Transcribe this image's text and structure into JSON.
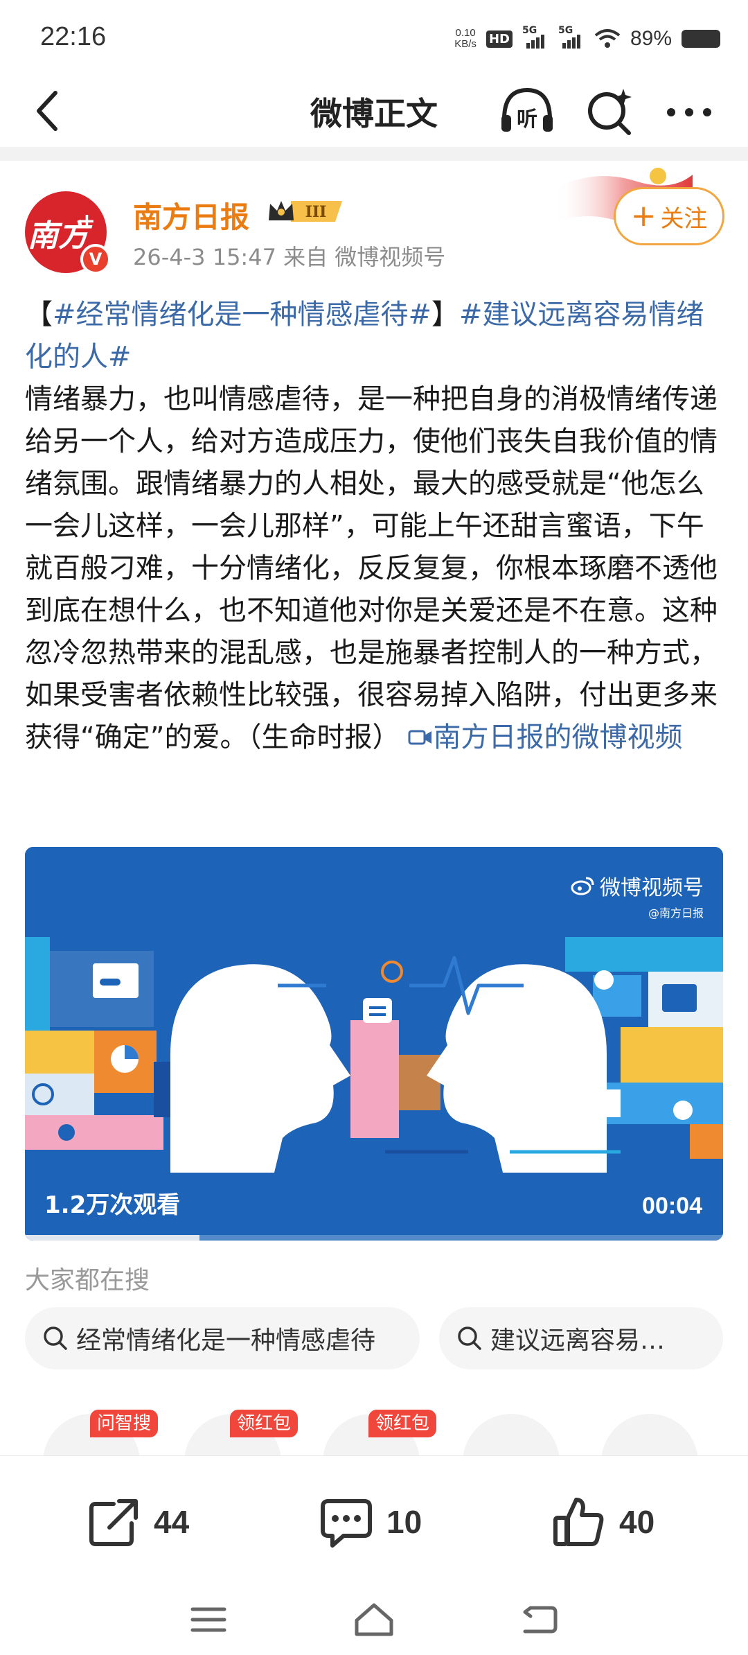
{
  "status_bar": {
    "time": "22:16",
    "net_speed_value": "0.10",
    "net_speed_unit": "KB/s",
    "hd_label": "HD",
    "sim1_label": "5G",
    "sim2_label": "5G",
    "battery": "89%"
  },
  "nav": {
    "title": "微博正文",
    "listen_label": "听"
  },
  "author": {
    "name": "南方日报",
    "avatar_text": "南方",
    "avatar_plus": "+",
    "verify_mark": "V",
    "level_badge": "III",
    "meta": "26-4-3 15:47  来自 微博视频号",
    "follow_plus": "+",
    "follow_label": "关注"
  },
  "post": {
    "bracket_open": "【",
    "tag1": "#经常情绪化是一种情感虐待#",
    "bracket_close": "】",
    "tag2": "#建议远离容易情绪化的人#",
    "body": "情绪暴力，也叫情感虐待，是一种把自身的消极情绪传递给另一个人，给对方造成压力，使他们丧失自我价值的情绪氛围。跟情绪暴力的人相处，最大的感受就是“他怎么一会儿这样，一会儿那样”，可能上午还甜言蜜语，下午就百般刁难，十分情绪化，反反复复，你根本琢磨不透他到底在想什么，也不知道他对你是关爱还是不在意。这种忽冷忽热带来的混乱感，也是施暴者控制人的一种方式，如果受害者依赖性比较强，很容易掉入陷阱，付出更多来获得“确定”的爱。（生命时报）",
    "video_link_label": "南方日报的微博视频"
  },
  "video": {
    "watermark_main": "微博视频号",
    "watermark_sub": "@南方日报",
    "views": "1.2万次观看",
    "duration": "00:04",
    "progress": 0.25
  },
  "hot_search": {
    "title": "大家都在搜",
    "chips": [
      "经常情绪化是一种情感虐待",
      "建议远离容易…"
    ]
  },
  "peek_badges": [
    "问智搜",
    "领红包",
    "领红包"
  ],
  "actions": {
    "share_count": "44",
    "comment_count": "10",
    "like_count": "40"
  },
  "colors": {
    "accent_orange": "#ea7c12",
    "link_blue": "#3c6aa8",
    "video_bg": "#1d63b8"
  }
}
